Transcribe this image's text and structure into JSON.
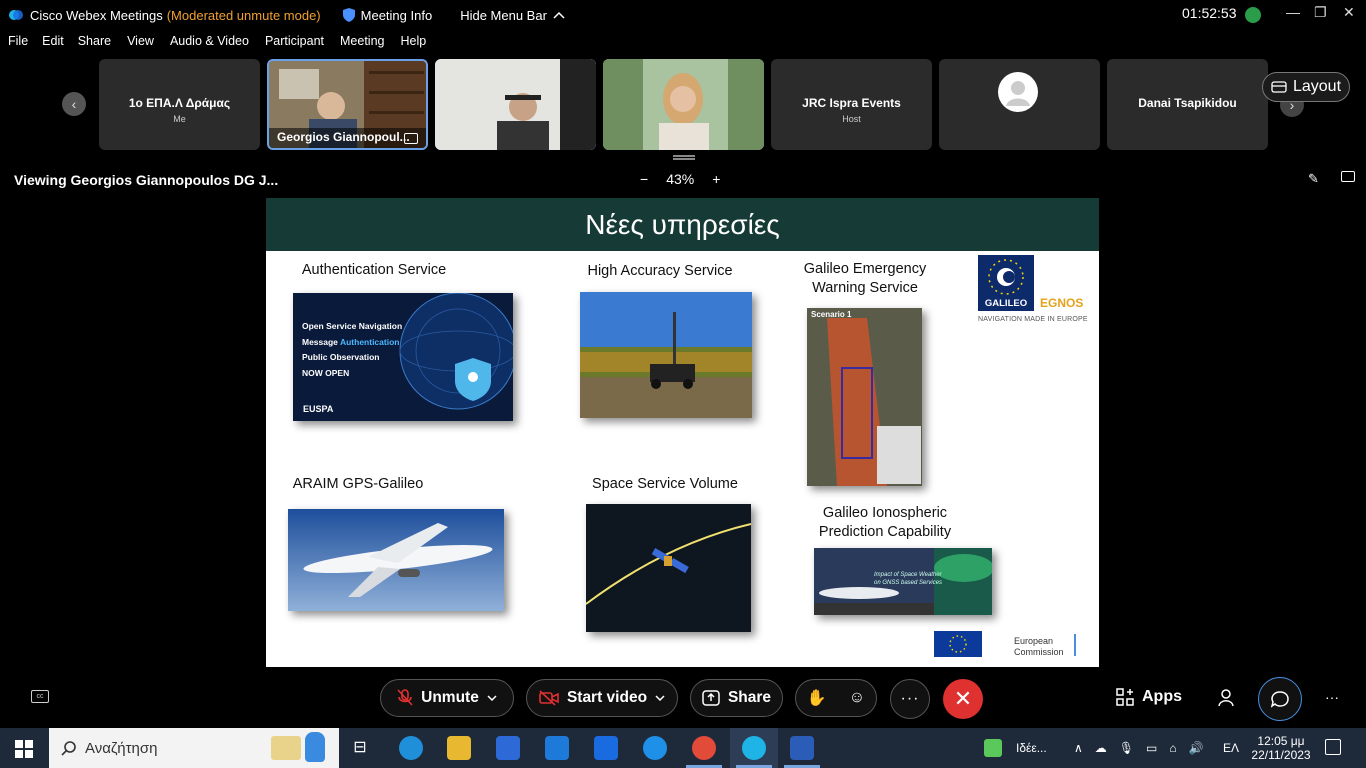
{
  "titlebar": {
    "app_name": "Cisco Webex Meetings",
    "mode": "(Moderated unmute mode)",
    "meeting_info": "Meeting Info",
    "hide_menu": "Hide Menu Bar",
    "clock": "01:52:53"
  },
  "menu": [
    "File",
    "Edit",
    "Share",
    "View",
    "Audio & Video",
    "Participant",
    "Meeting",
    "Help"
  ],
  "participants": [
    {
      "name": "1ο ΕΠΑ.Λ Δράμας",
      "role": "Me",
      "video": false
    },
    {
      "name": "Georgios Giannopoul...",
      "role": "",
      "video": true,
      "active": true
    },
    {
      "name": "",
      "role": "",
      "video": true
    },
    {
      "name": "",
      "role": "",
      "video": true
    },
    {
      "name": "JRC Ispra Events",
      "role": "Host",
      "video": false
    },
    {
      "name": "",
      "role": "",
      "video": false,
      "avatar": true
    },
    {
      "name": "Danai Tsapikidou",
      "role": "",
      "video": false
    }
  ],
  "layout_label": "Layout",
  "view": {
    "viewing": "Viewing Georgios Giannopoulos DG J...",
    "zoom": "43%"
  },
  "slide": {
    "title": "Νέες υπηρεσίες",
    "captions": {
      "auth": "Authentication Service",
      "has": "High Accuracy Service",
      "ews": "Galileo Emergency\nWarning Service",
      "araim": "ARAIM GPS-Galileo",
      "ssv": "Space Service Volume",
      "iono": "Galileo Ionospheric\nPrediction Capability"
    },
    "auth_lines": [
      "Open Service Navigation",
      "Message ",
      "Authentication",
      "Public Observation",
      "NOW OPEN"
    ],
    "euspa": "EUSPA",
    "scenario": "Scenario 1",
    "iono_text": "Impact of Space Weather\non GNSS based Services",
    "galileo": "GALILEO",
    "egnos": "EGNOS",
    "nav_europe": "NAVIGATION MADE IN EUROPE",
    "ec_line1": "European",
    "ec_line2": "Commission"
  },
  "controls": {
    "unmute": "Unmute",
    "start_video": "Start video",
    "share": "Share",
    "apps": "Apps"
  },
  "taskbar": {
    "search_placeholder": "Αναζήτηση",
    "ideas": "Ιδέε...",
    "lang": "ΕΛ",
    "time": "12:05 μμ",
    "date": "22/11/2023"
  },
  "colors": {
    "mode_orange": "#f0a030",
    "slide_header": "#163b36",
    "end_red": "#e03131",
    "active_border": "#6aa0e6"
  }
}
